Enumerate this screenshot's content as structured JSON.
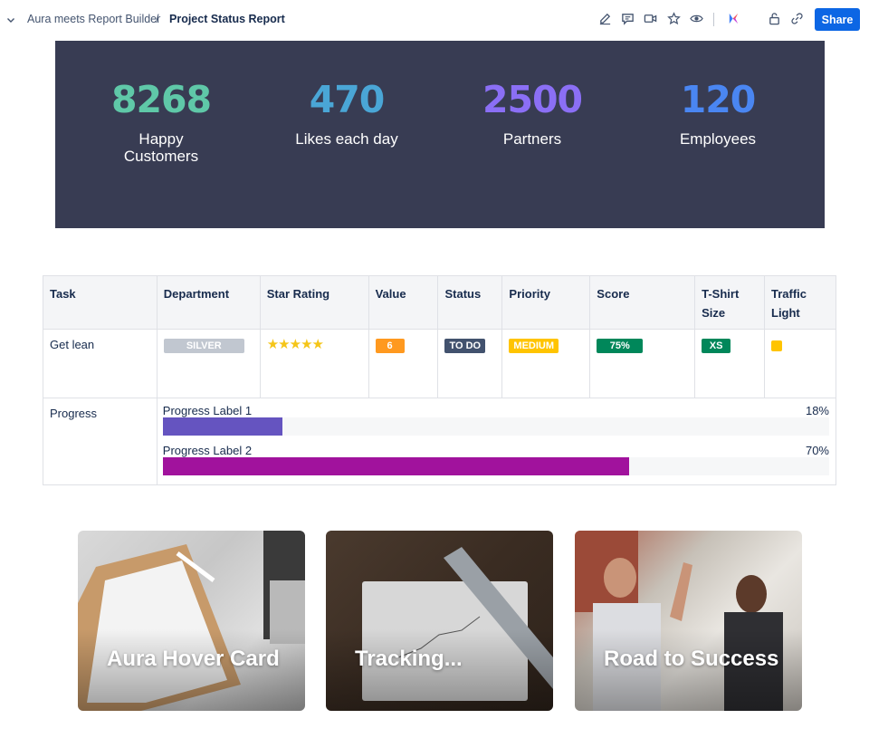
{
  "breadcrumb": {
    "parent": "Aura meets Report Builder",
    "separator": "/",
    "current": "Project Status Report"
  },
  "toolbar": {
    "icons": [
      "edit-icon",
      "comment-icon",
      "video-icon",
      "star-icon",
      "watch-icon",
      "app-logo-icon",
      "lock-icon",
      "link-icon"
    ],
    "share_label": "Share"
  },
  "stats": [
    {
      "value": "8268",
      "label": "Happy\nCustomers",
      "color": "#5fc8a8"
    },
    {
      "value": "470",
      "label": "Likes each day",
      "color": "#4aa6d6"
    },
    {
      "value": "2500",
      "label": "Partners",
      "color": "#8b6ff5"
    },
    {
      "value": "120",
      "label": "Employees",
      "color": "#4a86f2"
    }
  ],
  "table": {
    "headers": [
      "Task",
      "Department",
      "Star Rating",
      "Value",
      "Status",
      "Priority",
      "Score",
      "T-Shirt Size",
      "Traffic Light"
    ],
    "row": {
      "task": "Get lean",
      "department": "SILVER",
      "stars": "★★★★★",
      "star_rating": 5,
      "value": "6",
      "status": "TO DO",
      "priority": "MEDIUM",
      "score": "75%",
      "tshirt": "XS",
      "traffic_light": "#ffc400"
    },
    "progress": {
      "task": "Progress",
      "bars": [
        {
          "label": "Progress Label 1",
          "percent_text": "18%",
          "percent": 18,
          "color": "#6554c0"
        },
        {
          "label": "Progress Label 2",
          "percent_text": "70%",
          "percent": 70,
          "color": "#a1129d"
        }
      ]
    }
  },
  "cards": [
    {
      "title": "Aura Hover Card"
    },
    {
      "title": "Tracking..."
    },
    {
      "title": "Road to Success"
    }
  ]
}
